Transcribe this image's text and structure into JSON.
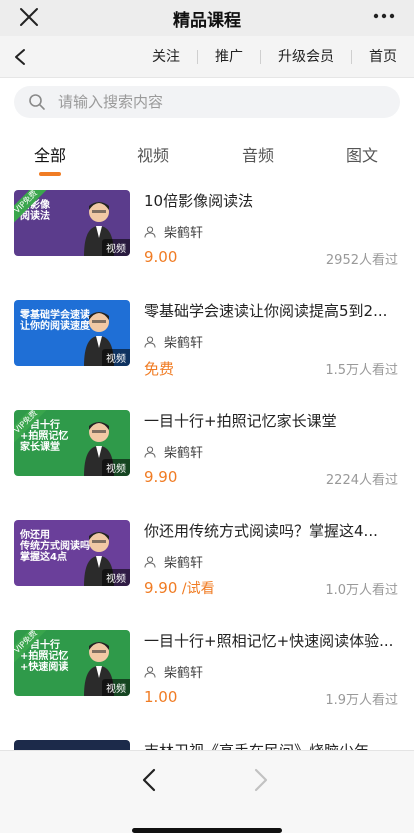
{
  "titlebar": {
    "title": "精品课程"
  },
  "navbar": {
    "links": [
      "关注",
      "推广",
      "升级会员",
      "首页"
    ]
  },
  "search": {
    "placeholder": "请输入搜索内容"
  },
  "tabs": [
    "全部",
    "视频",
    "音频",
    "图文"
  ],
  "active_tab": "全部",
  "accent_color": "#f07c24",
  "courses": [
    {
      "title": "10倍影像阅读法",
      "author": "柴鹤轩",
      "price": "9.00",
      "price_suffix": "",
      "views": "2952人看过",
      "badge": "视频",
      "vip": "VIP免费",
      "thumb_text": "倍影像\n阅读法",
      "thumb_bg": "#5b3c8c"
    },
    {
      "title": "零基础学会速读让你阅读提高5到2...",
      "author": "柴鹤轩",
      "price": "免费",
      "price_suffix": "",
      "views": "1.5万人看过",
      "badge": "视频",
      "vip": "",
      "thumb_text": "零基础学会速读\n让你的阅读速度",
      "thumb_bg": "#1f6fd6"
    },
    {
      "title": "一目十行+拍照记忆家长课堂",
      "author": "柴鹤轩",
      "price": "9.90",
      "price_suffix": "",
      "views": "2224人看过",
      "badge": "视频",
      "vip": "VIP免费",
      "thumb_text": "一目十行\n+拍照记忆\n家长课堂",
      "thumb_bg": "#2f9a4a"
    },
    {
      "title": "你还用传统方式阅读吗？掌握这4...",
      "author": "柴鹤轩",
      "price": "9.90",
      "price_suffix": " /试看",
      "views": "1.0万人看过",
      "badge": "视频",
      "vip": "",
      "thumb_text": "你还用\n传统方式阅读吗?\n掌握这4点",
      "thumb_bg": "#6a3f9a"
    },
    {
      "title": "一目十行+照相记忆+快速阅读体验...",
      "author": "柴鹤轩",
      "price": "1.00",
      "price_suffix": "",
      "views": "1.9万人看过",
      "badge": "视频",
      "vip": "VIP免费",
      "thumb_text": "一目十行\n+拍照记忆\n+快速阅读",
      "thumb_bg": "#2f9a4a"
    },
    {
      "title": "吉林卫视《高手在民间》烧脑少年...",
      "author": "",
      "price": "",
      "price_suffix": "",
      "views": "",
      "badge": "",
      "vip": "",
      "thumb_text": "",
      "thumb_bg": "#1c2a4a"
    }
  ],
  "icons": {
    "close": "close-icon",
    "more": "more-icon",
    "back": "chevron-left-icon",
    "search": "search-icon",
    "user": "user-icon",
    "forward": "chevron-right-icon"
  }
}
